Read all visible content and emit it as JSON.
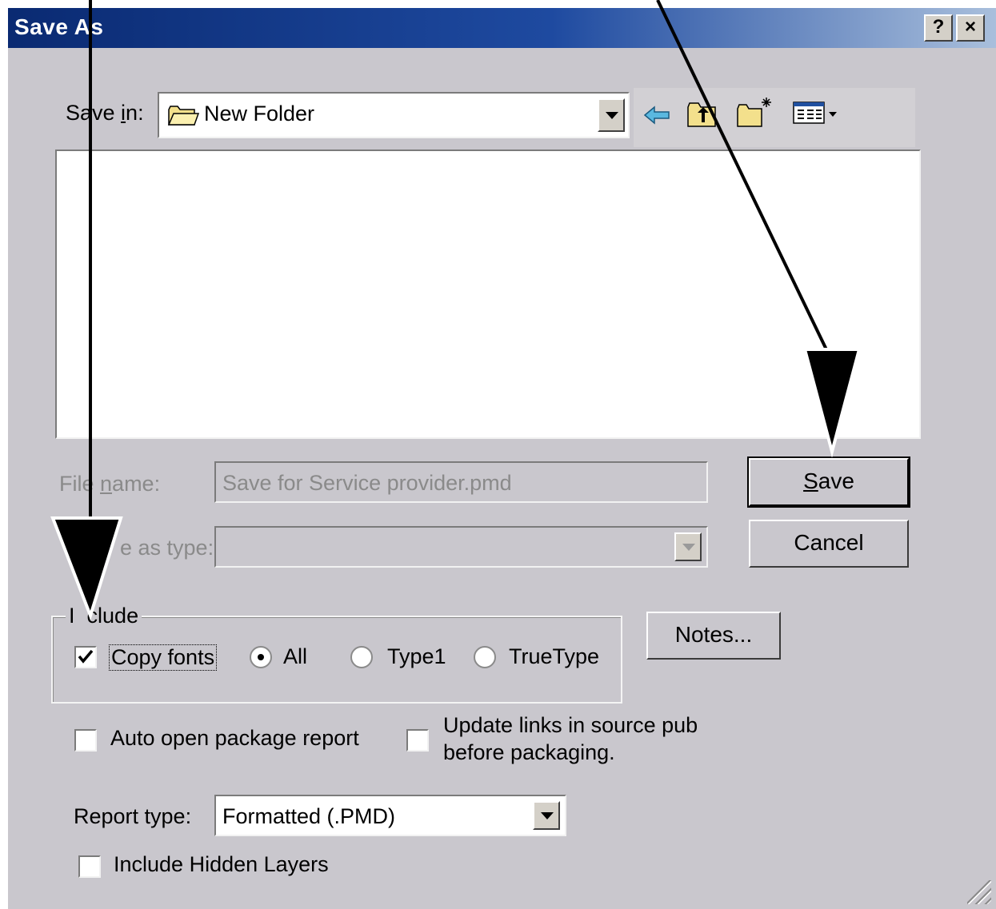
{
  "window": {
    "title": "Save As",
    "help_button": "?",
    "close_button": "×"
  },
  "toolbar": {
    "save_in_label_pre": "Save ",
    "save_in_label_key": "i",
    "save_in_label_post": "n:",
    "save_in_value": "New Folder",
    "icons": [
      "back-arrow-icon",
      "up-one-level-icon",
      "new-folder-icon",
      "view-menu-icon"
    ]
  },
  "file_name": {
    "label_pre": "File ",
    "label_key": "n",
    "label_post": "ame:",
    "value": "Save for Service provider.pmd"
  },
  "save_as_type": {
    "label_visible": "e as type:",
    "value": ""
  },
  "buttons": {
    "save_key": "S",
    "save_rest": "ave",
    "cancel": "Cancel",
    "notes": "Notes..."
  },
  "include": {
    "legend_visible_pre": "I",
    "legend_visible_post": "clude",
    "copy_fonts": "Copy fonts",
    "copy_fonts_checked": true,
    "radio_all": "All",
    "radio_type1": "Type1",
    "radio_truetype": "TrueType",
    "selected": "All"
  },
  "options": {
    "auto_open_report": "Auto open package report",
    "auto_open_report_checked": false,
    "update_links_line1": "Update links in source pub",
    "update_links_line2": "before packaging.",
    "update_links_checked": false,
    "report_type_label": "Report type:",
    "report_type_value": "Formatted (.PMD)",
    "include_hidden_layers": "Include Hidden Layers",
    "include_hidden_layers_checked": false
  },
  "colors": {
    "dialog_bg": "#c9c7cd",
    "titlebar_dark": "#0a2a72",
    "titlebar_light": "#a9bfdc"
  }
}
